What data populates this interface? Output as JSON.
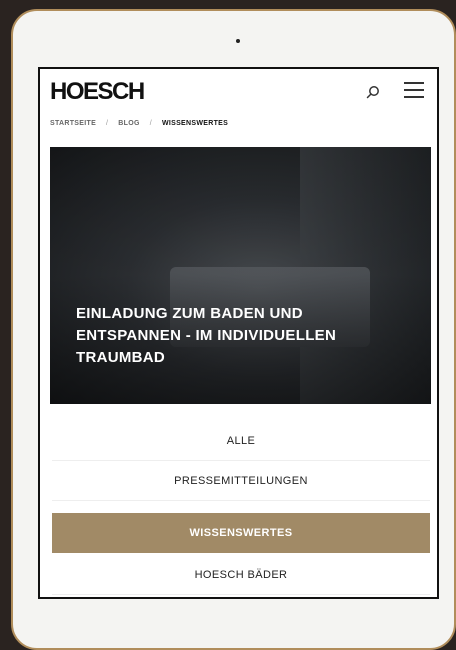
{
  "header": {
    "logo": "HOESCH"
  },
  "breadcrumb": {
    "items": [
      "STARTSEITE",
      "BLOG",
      "WISSENSWERTES"
    ],
    "separator": "/"
  },
  "hero": {
    "title": "EINLADUNG ZUM BADEN UND ENTSPANNEN - IM INDIVIDUELLEN TRAUMBAD"
  },
  "filters": {
    "items": [
      "ALLE",
      "PRESSEMITTEILUNGEN",
      "WISSENSWERTES",
      "HOESCH BÄDER"
    ],
    "active": "WISSENSWERTES"
  },
  "colors": {
    "accent": "#a18a66",
    "frame": "#b08d5b",
    "background": "#2a2320"
  }
}
